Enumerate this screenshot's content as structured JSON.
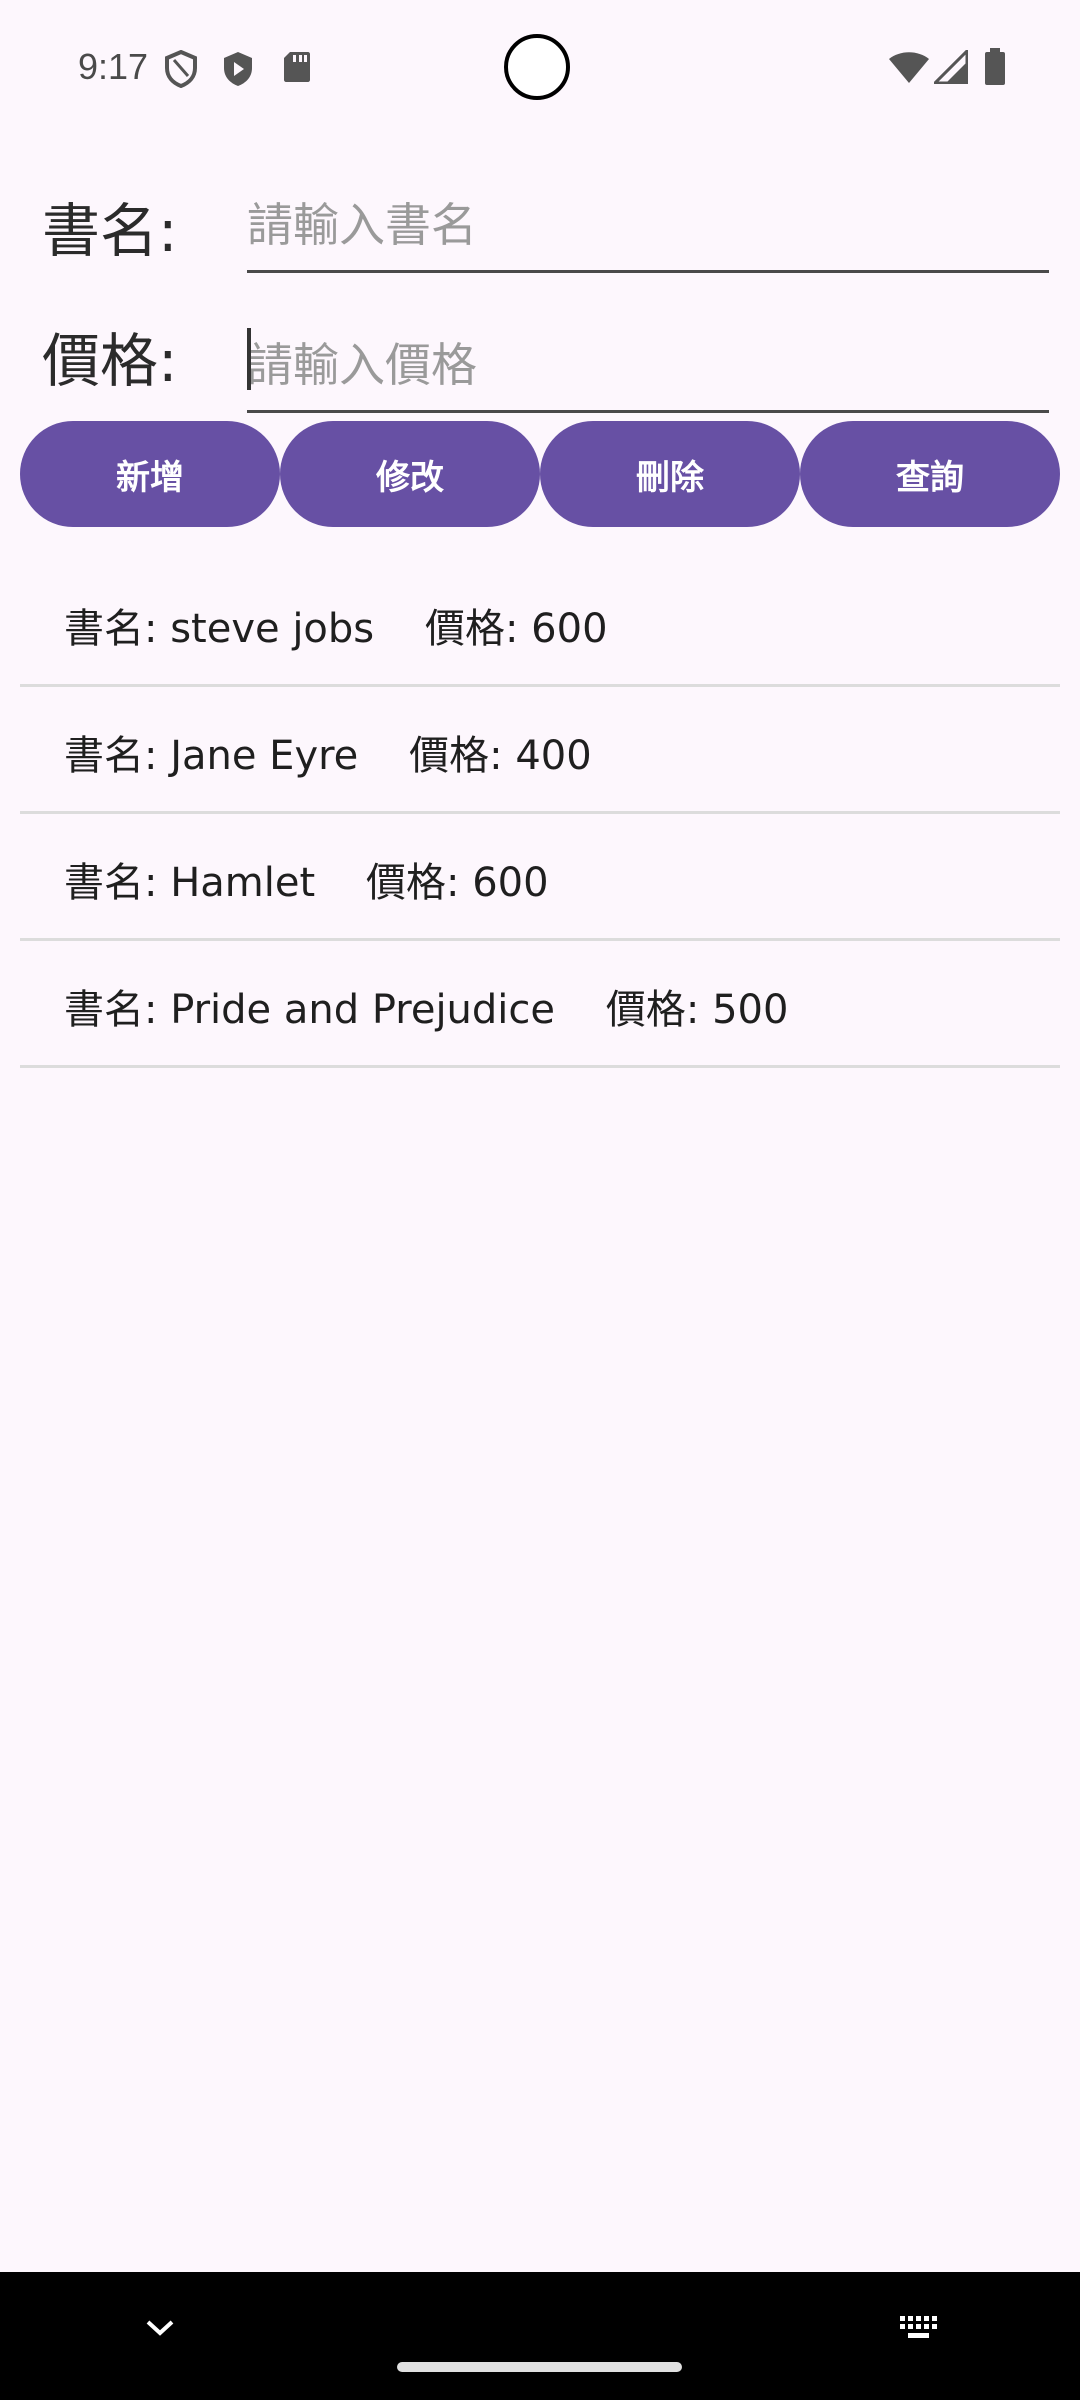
{
  "status_bar": {
    "time": "9:17",
    "icons_left": [
      "shield-outline-icon",
      "shield-play-icon",
      "sd-card-icon"
    ],
    "icons_right": [
      "wifi-icon",
      "signal-icon",
      "battery-icon"
    ]
  },
  "form": {
    "name_label": "書名:",
    "name_placeholder": "請輸入書名",
    "name_value": "",
    "price_label": "價格:",
    "price_placeholder": "請輸入價格",
    "price_value": ""
  },
  "buttons": {
    "add": "新增",
    "edit": "修改",
    "delete": "刪除",
    "query": "查詢"
  },
  "books": [
    {
      "text": "書名: steve jobs    價格: 600"
    },
    {
      "text": "書名: Jane Eyre    價格: 400"
    },
    {
      "text": "書名: Hamlet    價格: 600"
    },
    {
      "text": "書名: Pride and Prejudice    價格: 500"
    }
  ],
  "nav_bar": {
    "icons": [
      "chevron-down-icon",
      "keyboard-icon"
    ]
  },
  "colors": {
    "background": "#fdf7fd",
    "accent": "#6750a4",
    "divider": "#dcdcdc"
  }
}
